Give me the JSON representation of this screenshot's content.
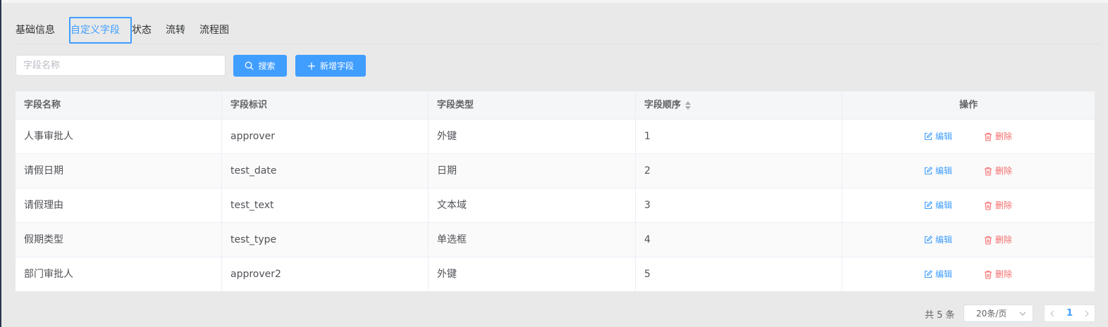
{
  "tabs": [
    "基础信息",
    "自定义字段",
    "状态",
    "流转",
    "流程图"
  ],
  "search": {
    "placeholder": "字段名称",
    "search_label": "搜索",
    "add_label": "新增字段"
  },
  "table": {
    "headers": [
      "字段名称",
      "字段标识",
      "字段类型",
      "字段顺序",
      "操作"
    ],
    "rows": [
      {
        "name": "人事审批人",
        "key": "approver",
        "type": "外键",
        "order": "1"
      },
      {
        "name": "请假日期",
        "key": "test_date",
        "type": "日期",
        "order": "2"
      },
      {
        "name": "请假理由",
        "key": "test_text",
        "type": "文本域",
        "order": "3"
      },
      {
        "name": "假期类型",
        "key": "test_type",
        "type": "单选框",
        "order": "4"
      },
      {
        "name": "部门审批人",
        "key": "approver2",
        "type": "外键",
        "order": "5"
      }
    ],
    "edit_label": "编辑",
    "delete_label": "删除"
  },
  "pagination": {
    "total": "共 5 条",
    "page_size": "20条/页",
    "current_page": "1"
  },
  "colors": {
    "primary": "#409eff",
    "danger": "#f56c6c"
  }
}
